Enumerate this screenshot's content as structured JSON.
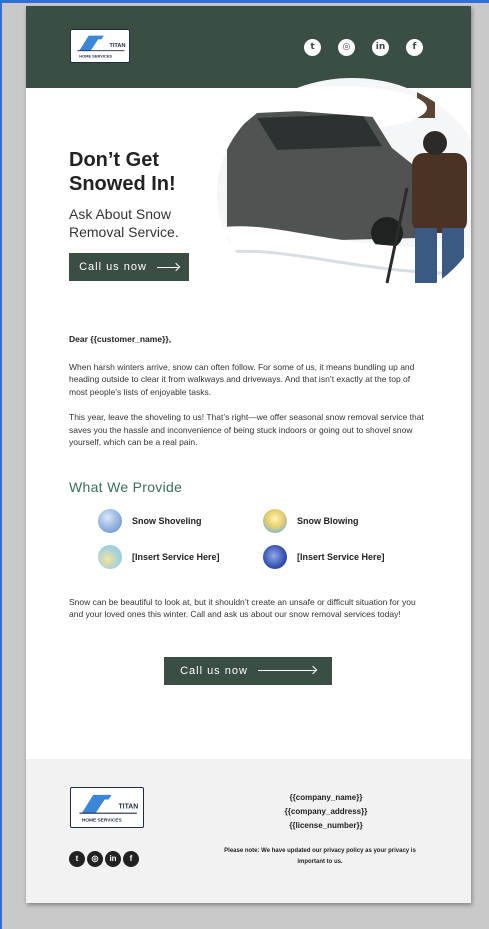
{
  "brand": {
    "line1": "TITAN",
    "line2": "HOME SERVICES"
  },
  "header": {
    "social_icons": [
      {
        "icon": "twitter-icon",
        "glyph": "t"
      },
      {
        "icon": "instagram-icon",
        "glyph": "◎"
      },
      {
        "icon": "linkedin-icon",
        "glyph": "in"
      },
      {
        "icon": "facebook-icon",
        "glyph": "f"
      }
    ]
  },
  "hero": {
    "headline": "Don’t Get Snowed In!",
    "subhead": "Ask About Snow Removal Service.",
    "cta_label": "Call us now"
  },
  "body": {
    "greeting": "Dear {{customer_name}},",
    "paragraph1": "When harsh winters arrive, snow can often follow. For some of us, it means bundling up and heading outside to clear it from walkways and driveways. And that isn’t exactly at the top of most people’s lists of enjoyable tasks.",
    "paragraph2": "This year, leave the shoveling to us! That’s right—we offer seasonal snow removal service that saves you the hassle and inconvenience of being stuck indoors or going out to shovel snow yourself, which can be a real pain.",
    "section_title": "What We Provide",
    "services": [
      {
        "label": "Snow Shoveling",
        "color": "#7fa3d6"
      },
      {
        "label": "Snow Blowing",
        "color": "#e8cf6a"
      },
      {
        "label": "[Insert Service Here]",
        "color": "#9fd0e0"
      },
      {
        "label": "[Insert Service Here]",
        "color": "#2f4aa8"
      }
    ],
    "paragraph3": "Snow can be beautiful to look at, but it shouldn’t create an unsafe or difficult situation for you and your loved ones this winter. Call and ask us about our snow removal services today!",
    "cta_label": "Call us now"
  },
  "footer": {
    "company_name": "{{company_name}}",
    "company_address": "{{company_address}}",
    "license_number": "{{license_number}}",
    "note": "Please note: We have updated our privacy policy as your privacy is important to us.",
    "social_icons": [
      {
        "icon": "twitter-icon",
        "glyph": "t"
      },
      {
        "icon": "instagram-icon",
        "glyph": "◎"
      },
      {
        "icon": "linkedin-icon",
        "glyph": "in"
      },
      {
        "icon": "facebook-icon",
        "glyph": "f"
      }
    ]
  },
  "colors": {
    "brand_green": "#3b4e44",
    "heading_green": "#3b6e5a",
    "logo_blue": "#3a86d8"
  }
}
